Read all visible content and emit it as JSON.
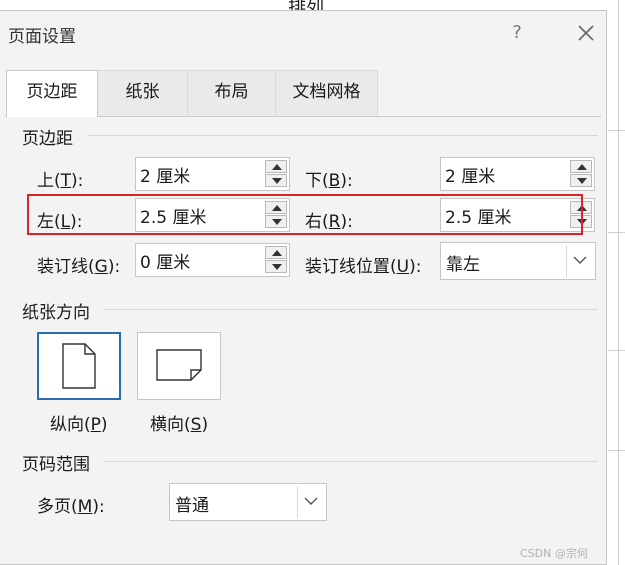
{
  "background": {
    "top_text": "排列"
  },
  "dialog": {
    "title": "页面设置",
    "help_label": "?",
    "tabs": [
      {
        "label": "页边距",
        "active": true
      },
      {
        "label": "纸张",
        "active": false
      },
      {
        "label": "布局",
        "active": false
      },
      {
        "label": "文档网格",
        "active": false
      }
    ]
  },
  "margins": {
    "section_title": "页边距",
    "top": {
      "label": "上",
      "key": "T",
      "value": "2 厘米"
    },
    "bottom": {
      "label": "下",
      "key": "B",
      "value": "2 厘米"
    },
    "left": {
      "label": "左",
      "key": "L",
      "value": "2.5 厘米"
    },
    "right": {
      "label": "右",
      "key": "R",
      "value": "2.5 厘米"
    },
    "gutter": {
      "label": "装订线",
      "key": "G",
      "value": "0 厘米"
    },
    "gutter_pos": {
      "label": "装订线位置",
      "key": "U",
      "value": "靠左"
    }
  },
  "orientation": {
    "section_title": "纸张方向",
    "portrait": {
      "label": "纵向",
      "key": "P",
      "selected": true
    },
    "landscape": {
      "label": "横向",
      "key": "S",
      "selected": false
    }
  },
  "pages": {
    "section_title": "页码范围",
    "multi": {
      "label": "多页",
      "key": "M",
      "value": "普通"
    }
  },
  "watermark": "CSDN @宗何",
  "colors": {
    "highlight": "#d9252a",
    "selected_border": "#2b6cb0"
  }
}
